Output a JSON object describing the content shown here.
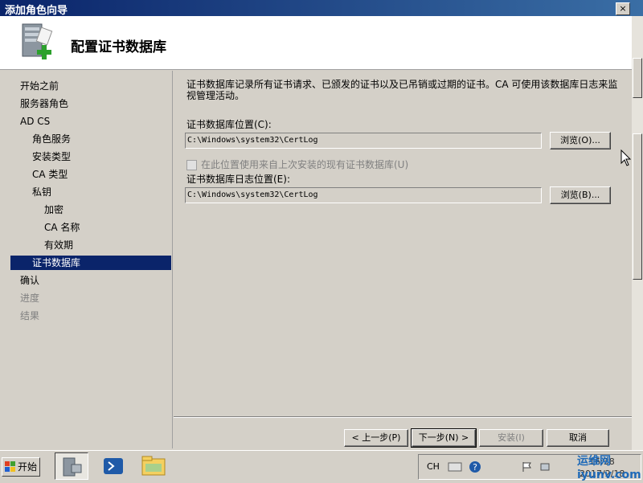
{
  "window": {
    "title": "添加角色向导",
    "close_label": "×"
  },
  "header": {
    "page_title": "配置证书数据库",
    "icon": "server-add-icon"
  },
  "nav": {
    "items": [
      {
        "label": "开始之前",
        "state": "normal"
      },
      {
        "label": "服务器角色",
        "state": "normal"
      },
      {
        "label": "AD CS",
        "state": "normal"
      },
      {
        "label": "角色服务",
        "state": "normal"
      },
      {
        "label": "安装类型",
        "state": "normal"
      },
      {
        "label": "CA 类型",
        "state": "normal"
      },
      {
        "label": "私钥",
        "state": "normal"
      },
      {
        "label": "加密",
        "state": "normal"
      },
      {
        "label": "CA 名称",
        "state": "normal"
      },
      {
        "label": "有效期",
        "state": "normal"
      },
      {
        "label": "证书数据库",
        "state": "selected"
      },
      {
        "label": "确认",
        "state": "normal"
      },
      {
        "label": "进度",
        "state": "disabled"
      },
      {
        "label": "结果",
        "state": "disabled"
      }
    ]
  },
  "content": {
    "description": "证书数据库记录所有证书请求、已颁发的证书以及已吊销或过期的证书。CA 可使用该数据库日志来监视管理活动。",
    "db_location_label": "证书数据库位置(C):",
    "db_location_value": "C:\\Windows\\system32\\CertLog",
    "browse_db_label": "浏览(O)...",
    "reuse_checkbox_label": "在此位置使用来自上次安装的现有证书数据库(U)",
    "log_location_label": "证书数据库日志位置(E):",
    "log_location_value": "C:\\Windows\\system32\\CertLog",
    "browse_log_label": "浏览(B)..."
  },
  "footer": {
    "back_label": "< 上一步(P)",
    "next_label": "下一步(N) >",
    "install_label": "安装(I)",
    "cancel_label": "取消"
  },
  "taskbar": {
    "start_label": "开始",
    "lang": "CH",
    "clock_time": "16:38",
    "clock_date": "2017/2/18",
    "watermark": "运维网 iyunv.com"
  }
}
